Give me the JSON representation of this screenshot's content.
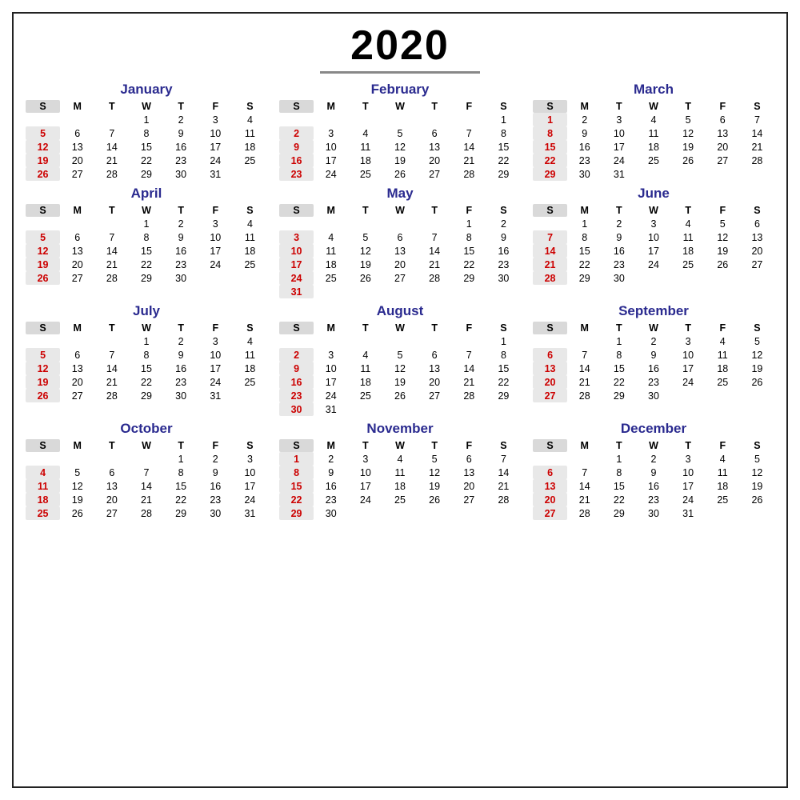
{
  "year": "2020",
  "months": [
    {
      "name": "January",
      "startDay": 3,
      "days": 31,
      "weeks": [
        [
          "",
          "",
          "1",
          "2",
          "3",
          "4"
        ],
        [
          "5",
          "6",
          "7",
          "8",
          "9",
          "10",
          "11"
        ],
        [
          "12",
          "13",
          "14",
          "15",
          "16",
          "17",
          "18"
        ],
        [
          "19",
          "20",
          "21",
          "22",
          "23",
          "24",
          "25"
        ],
        [
          "26",
          "27",
          "28",
          "29",
          "30",
          "31",
          ""
        ]
      ]
    },
    {
      "name": "February",
      "startDay": 6,
      "days": 29,
      "weeks": [
        [
          "",
          "",
          "",
          "",
          "",
          "",
          "1"
        ],
        [
          "2",
          "3",
          "4",
          "5",
          "6",
          "7",
          "8"
        ],
        [
          "9",
          "10",
          "11",
          "12",
          "13",
          "14",
          "15"
        ],
        [
          "16",
          "17",
          "18",
          "19",
          "20",
          "21",
          "22"
        ],
        [
          "23",
          "24",
          "25",
          "26",
          "27",
          "28",
          "29"
        ]
      ]
    },
    {
      "name": "March",
      "startDay": 0,
      "days": 31,
      "weeks": [
        [
          "1",
          "2",
          "3",
          "4",
          "5",
          "6",
          "7"
        ],
        [
          "8",
          "9",
          "10",
          "11",
          "12",
          "13",
          "14"
        ],
        [
          "15",
          "16",
          "17",
          "18",
          "19",
          "20",
          "21"
        ],
        [
          "22",
          "23",
          "24",
          "25",
          "26",
          "27",
          "28"
        ],
        [
          "29",
          "30",
          "31",
          "",
          "",
          "",
          ""
        ]
      ]
    },
    {
      "name": "April",
      "startDay": 3,
      "days": 30,
      "weeks": [
        [
          "",
          "",
          "1",
          "2",
          "3",
          "4"
        ],
        [
          "5",
          "6",
          "7",
          "8",
          "9",
          "10",
          "11"
        ],
        [
          "12",
          "13",
          "14",
          "15",
          "16",
          "17",
          "18"
        ],
        [
          "19",
          "20",
          "21",
          "22",
          "23",
          "24",
          "25"
        ],
        [
          "26",
          "27",
          "28",
          "29",
          "30",
          "",
          ""
        ]
      ]
    },
    {
      "name": "May",
      "startDay": 5,
      "days": 31,
      "weeks": [
        [
          "",
          "",
          "",
          "",
          "",
          "1",
          "2"
        ],
        [
          "3",
          "4",
          "5",
          "6",
          "7",
          "8",
          "9"
        ],
        [
          "10",
          "11",
          "12",
          "13",
          "14",
          "15",
          "16"
        ],
        [
          "17",
          "18",
          "19",
          "20",
          "21",
          "22",
          "23"
        ],
        [
          "24",
          "25",
          "26",
          "27",
          "28",
          "29",
          "30"
        ],
        [
          "31",
          "",
          "",
          "",
          "",
          "",
          ""
        ]
      ]
    },
    {
      "name": "June",
      "startDay": 1,
      "days": 30,
      "weeks": [
        [
          "",
          "1",
          "2",
          "3",
          "4",
          "5",
          "6"
        ],
        [
          "7",
          "8",
          "9",
          "10",
          "11",
          "12",
          "13"
        ],
        [
          "14",
          "15",
          "16",
          "17",
          "18",
          "19",
          "20"
        ],
        [
          "21",
          "22",
          "23",
          "24",
          "25",
          "26",
          "27"
        ],
        [
          "28",
          "29",
          "30",
          "",
          "",
          "",
          ""
        ]
      ]
    },
    {
      "name": "July",
      "startDay": 3,
      "days": 31,
      "weeks": [
        [
          "",
          "",
          "1",
          "2",
          "3",
          "4"
        ],
        [
          "5",
          "6",
          "7",
          "8",
          "9",
          "10",
          "11"
        ],
        [
          "12",
          "13",
          "14",
          "15",
          "16",
          "17",
          "18"
        ],
        [
          "19",
          "20",
          "21",
          "22",
          "23",
          "24",
          "25"
        ],
        [
          "26",
          "27",
          "28",
          "29",
          "30",
          "31",
          ""
        ]
      ]
    },
    {
      "name": "August",
      "startDay": 6,
      "days": 31,
      "weeks": [
        [
          "",
          "",
          "",
          "",
          "",
          "",
          "1"
        ],
        [
          "2",
          "3",
          "4",
          "5",
          "6",
          "7",
          "8"
        ],
        [
          "9",
          "10",
          "11",
          "12",
          "13",
          "14",
          "15"
        ],
        [
          "16",
          "17",
          "18",
          "19",
          "20",
          "21",
          "22"
        ],
        [
          "23",
          "24",
          "25",
          "26",
          "27",
          "28",
          "29"
        ],
        [
          "30",
          "31",
          "",
          "",
          "",
          "",
          ""
        ]
      ]
    },
    {
      "name": "September",
      "startDay": 2,
      "days": 30,
      "weeks": [
        [
          "",
          "1",
          "2",
          "3",
          "4",
          "5"
        ],
        [
          "6",
          "7",
          "8",
          "9",
          "10",
          "11",
          "12"
        ],
        [
          "13",
          "14",
          "15",
          "16",
          "17",
          "18",
          "19"
        ],
        [
          "20",
          "21",
          "22",
          "23",
          "24",
          "25",
          "26"
        ],
        [
          "27",
          "28",
          "29",
          "30",
          "",
          "",
          ""
        ]
      ]
    },
    {
      "name": "October",
      "startDay": 4,
      "days": 31,
      "weeks": [
        [
          "",
          "",
          "",
          "1",
          "2",
          "3"
        ],
        [
          "4",
          "5",
          "6",
          "7",
          "8",
          "9",
          "10"
        ],
        [
          "11",
          "12",
          "13",
          "14",
          "15",
          "16",
          "17"
        ],
        [
          "18",
          "19",
          "20",
          "21",
          "22",
          "23",
          "24"
        ],
        [
          "25",
          "26",
          "27",
          "28",
          "29",
          "30",
          "31"
        ]
      ]
    },
    {
      "name": "November",
      "startDay": 0,
      "days": 30,
      "weeks": [
        [
          "1",
          "2",
          "3",
          "4",
          "5",
          "6",
          "7"
        ],
        [
          "8",
          "9",
          "10",
          "11",
          "12",
          "13",
          "14"
        ],
        [
          "15",
          "16",
          "17",
          "18",
          "19",
          "20",
          "21"
        ],
        [
          "22",
          "23",
          "24",
          "25",
          "26",
          "27",
          "28"
        ],
        [
          "29",
          "30",
          "",
          "",
          "",
          "",
          ""
        ]
      ]
    },
    {
      "name": "December",
      "startDay": 2,
      "days": 31,
      "weeks": [
        [
          "",
          "1",
          "2",
          "3",
          "4",
          "5"
        ],
        [
          "6",
          "7",
          "8",
          "9",
          "10",
          "11",
          "12"
        ],
        [
          "13",
          "14",
          "15",
          "16",
          "17",
          "18",
          "19"
        ],
        [
          "20",
          "21",
          "22",
          "23",
          "24",
          "25",
          "26"
        ],
        [
          "27",
          "28",
          "29",
          "30",
          "31",
          "",
          ""
        ]
      ]
    }
  ],
  "dayHeaders": [
    "S",
    "M",
    "T",
    "W",
    "T",
    "F",
    "S"
  ]
}
